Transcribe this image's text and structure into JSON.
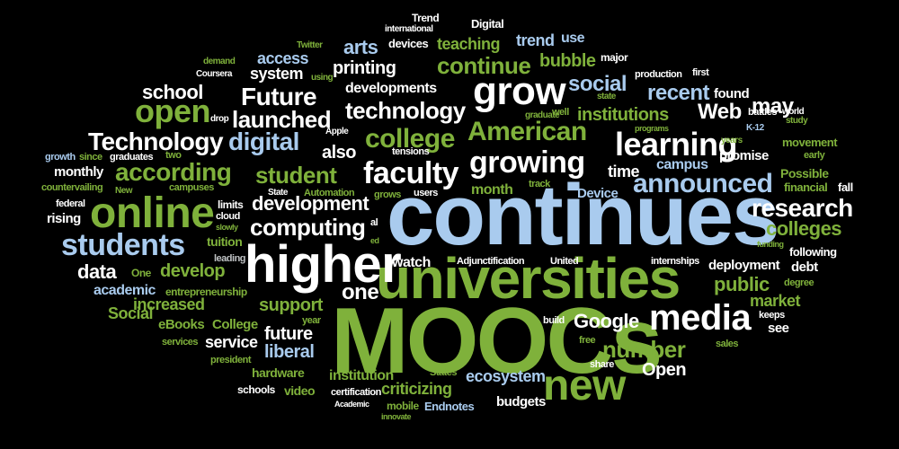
{
  "words": [
    {
      "text": "continues",
      "color": "#a9cbee"
    },
    {
      "text": "MOOCs",
      "color": "#7fb13b"
    },
    {
      "text": "universities",
      "color": "#7fb13b"
    },
    {
      "text": "higher",
      "color": "#ffffff"
    },
    {
      "text": "online",
      "color": "#7fb13b"
    },
    {
      "text": "new",
      "color": "#7fb13b"
    },
    {
      "text": "media",
      "color": "#ffffff"
    },
    {
      "text": "grow",
      "color": "#ffffff"
    },
    {
      "text": "students",
      "color": "#a9cbee"
    },
    {
      "text": "learning",
      "color": "#ffffff"
    },
    {
      "text": "growing",
      "color": "#ffffff"
    },
    {
      "text": "American",
      "color": "#7fb13b"
    },
    {
      "text": "faculty",
      "color": "#ffffff"
    },
    {
      "text": "college",
      "color": "#7fb13b"
    },
    {
      "text": "announced",
      "color": "#a9cbee"
    },
    {
      "text": "research",
      "color": "#ffffff"
    },
    {
      "text": "open",
      "color": "#7fb13b"
    },
    {
      "text": "according",
      "color": "#7fb13b"
    },
    {
      "text": "Technology",
      "color": "#ffffff"
    },
    {
      "text": "digital",
      "color": "#a9cbee"
    },
    {
      "text": "Future",
      "color": "#ffffff"
    },
    {
      "text": "launched",
      "color": "#ffffff"
    },
    {
      "text": "technology",
      "color": "#ffffff"
    },
    {
      "text": "continue",
      "color": "#7fb13b"
    },
    {
      "text": "student",
      "color": "#7fb13b"
    },
    {
      "text": "development",
      "color": "#ffffff"
    },
    {
      "text": "computing",
      "color": "#ffffff"
    },
    {
      "text": "Web",
      "color": "#ffffff"
    },
    {
      "text": "institutions",
      "color": "#7fb13b"
    },
    {
      "text": "recent",
      "color": "#a9cbee"
    },
    {
      "text": "social",
      "color": "#a9cbee"
    },
    {
      "text": "may",
      "color": "#ffffff"
    },
    {
      "text": "colleges",
      "color": "#7fb13b"
    },
    {
      "text": "arts",
      "color": "#a9cbee"
    },
    {
      "text": "teaching",
      "color": "#7fb13b"
    },
    {
      "text": "trend",
      "color": "#a9cbee"
    },
    {
      "text": "use",
      "color": "#a9cbee"
    },
    {
      "text": "bubble",
      "color": "#7fb13b"
    },
    {
      "text": "printing",
      "color": "#ffffff"
    },
    {
      "text": "developments",
      "color": "#ffffff"
    },
    {
      "text": "access",
      "color": "#a9cbee"
    },
    {
      "text": "system",
      "color": "#ffffff"
    },
    {
      "text": "school",
      "color": "#ffffff"
    },
    {
      "text": "number",
      "color": "#7fb13b"
    },
    {
      "text": "Google",
      "color": "#ffffff"
    },
    {
      "text": "public",
      "color": "#7fb13b"
    },
    {
      "text": "market",
      "color": "#7fb13b"
    },
    {
      "text": "one",
      "color": "#ffffff"
    },
    {
      "text": "data",
      "color": "#ffffff"
    },
    {
      "text": "develop",
      "color": "#7fb13b"
    },
    {
      "text": "support",
      "color": "#7fb13b"
    },
    {
      "text": "future",
      "color": "#ffffff"
    },
    {
      "text": "liberal",
      "color": "#a9cbee"
    },
    {
      "text": "increased",
      "color": "#7fb13b"
    },
    {
      "text": "Social",
      "color": "#7fb13b"
    },
    {
      "text": "service",
      "color": "#ffffff"
    },
    {
      "text": "watch",
      "color": "#ffffff"
    },
    {
      "text": "Open",
      "color": "#ffffff"
    },
    {
      "text": "criticizing",
      "color": "#7fb13b"
    },
    {
      "text": "ecosystem",
      "color": "#a9cbee"
    },
    {
      "text": "institution",
      "color": "#7fb13b"
    },
    {
      "text": "also",
      "color": "#ffffff"
    },
    {
      "text": "time",
      "color": "#ffffff"
    },
    {
      "text": "campus",
      "color": "#a9cbee"
    },
    {
      "text": "month",
      "color": "#7fb13b"
    },
    {
      "text": "Device",
      "color": "#a9cbee"
    },
    {
      "text": "deployment",
      "color": "#ffffff"
    },
    {
      "text": "debt",
      "color": "#ffffff"
    },
    {
      "text": "following",
      "color": "#ffffff"
    },
    {
      "text": "found",
      "color": "#ffffff"
    },
    {
      "text": "promise",
      "color": "#ffffff"
    },
    {
      "text": "Possible",
      "color": "#7fb13b"
    },
    {
      "text": "financial",
      "color": "#7fb13b"
    },
    {
      "text": "fall",
      "color": "#ffffff"
    },
    {
      "text": "monthly",
      "color": "#ffffff"
    },
    {
      "text": "academic",
      "color": "#a9cbee"
    },
    {
      "text": "eBooks",
      "color": "#7fb13b"
    },
    {
      "text": "College",
      "color": "#7fb13b"
    },
    {
      "text": "entrepreneurship",
      "color": "#7fb13b"
    },
    {
      "text": "tuition",
      "color": "#7fb13b"
    },
    {
      "text": "leading",
      "color": "#bfc2c4"
    },
    {
      "text": "One",
      "color": "#7fb13b"
    },
    {
      "text": "Adjunctification",
      "color": "#ffffff"
    },
    {
      "text": "United",
      "color": "#ffffff"
    },
    {
      "text": "internships",
      "color": "#ffffff"
    },
    {
      "text": "degree",
      "color": "#7fb13b"
    },
    {
      "text": "keeps",
      "color": "#ffffff"
    },
    {
      "text": "see",
      "color": "#ffffff"
    },
    {
      "text": "sales",
      "color": "#7fb13b"
    },
    {
      "text": "free",
      "color": "#7fb13b"
    },
    {
      "text": "build",
      "color": "#ffffff"
    },
    {
      "text": "share",
      "color": "#ffffff"
    },
    {
      "text": "States",
      "color": "#7fb13b"
    },
    {
      "text": "hardware",
      "color": "#7fb13b"
    },
    {
      "text": "president",
      "color": "#7fb13b"
    },
    {
      "text": "services",
      "color": "#7fb13b"
    },
    {
      "text": "schools",
      "color": "#ffffff"
    },
    {
      "text": "video",
      "color": "#7fb13b"
    },
    {
      "text": "certification",
      "color": "#ffffff"
    },
    {
      "text": "Academic",
      "color": "#ffffff"
    },
    {
      "text": "mobile",
      "color": "#7fb13b"
    },
    {
      "text": "Endnotes",
      "color": "#a9cbee"
    },
    {
      "text": "budgets",
      "color": "#ffffff"
    },
    {
      "text": "innovate",
      "color": "#7fb13b"
    },
    {
      "text": "year",
      "color": "#7fb13b"
    },
    {
      "text": "federal",
      "color": "#ffffff"
    },
    {
      "text": "rising",
      "color": "#ffffff"
    },
    {
      "text": "countervailing",
      "color": "#7fb13b"
    },
    {
      "text": "growth",
      "color": "#a9cbee"
    },
    {
      "text": "since",
      "color": "#7fb13b"
    },
    {
      "text": "graduates",
      "color": "#ffffff"
    },
    {
      "text": "two",
      "color": "#7fb13b"
    },
    {
      "text": "New",
      "color": "#7fb13b"
    },
    {
      "text": "campuses",
      "color": "#7fb13b"
    },
    {
      "text": "limits",
      "color": "#ffffff"
    },
    {
      "text": "cloud",
      "color": "#ffffff"
    },
    {
      "text": "slowly",
      "color": "#7fb13b"
    },
    {
      "text": "State",
      "color": "#ffffff"
    },
    {
      "text": "Automation",
      "color": "#7fb13b"
    },
    {
      "text": "grows",
      "color": "#7fb13b"
    },
    {
      "text": "users",
      "color": "#ffffff"
    },
    {
      "text": "tensions",
      "color": "#ffffff"
    },
    {
      "text": "track",
      "color": "#7fb13b"
    },
    {
      "text": "Apple",
      "color": "#ffffff"
    },
    {
      "text": "drop",
      "color": "#ffffff"
    },
    {
      "text": "graduate",
      "color": "#7fb13b"
    },
    {
      "text": "well",
      "color": "#7fb13b"
    },
    {
      "text": "programs",
      "color": "#7fb13b"
    },
    {
      "text": "state",
      "color": "#7fb13b"
    },
    {
      "text": "production",
      "color": "#ffffff"
    },
    {
      "text": "first",
      "color": "#ffffff"
    },
    {
      "text": "study",
      "color": "#7fb13b"
    },
    {
      "text": "battles",
      "color": "#ffffff"
    },
    {
      "text": "world",
      "color": "#ffffff"
    },
    {
      "text": "K-12",
      "color": "#a9cbee"
    },
    {
      "text": "movement",
      "color": "#7fb13b"
    },
    {
      "text": "early",
      "color": "#7fb13b"
    },
    {
      "text": "years",
      "color": "#7fb13b"
    },
    {
      "text": "funding",
      "color": "#7fb13b"
    },
    {
      "text": "major",
      "color": "#ffffff"
    },
    {
      "text": "Trend",
      "color": "#ffffff"
    },
    {
      "text": "international",
      "color": "#ffffff"
    },
    {
      "text": "Digital",
      "color": "#ffffff"
    },
    {
      "text": "devices",
      "color": "#ffffff"
    },
    {
      "text": "Twitter",
      "color": "#7fb13b"
    },
    {
      "text": "demand",
      "color": "#7fb13b"
    },
    {
      "text": "Coursera",
      "color": "#ffffff"
    },
    {
      "text": "using",
      "color": "#7fb13b"
    },
    {
      "text": "al",
      "color": "#ffffff"
    },
    {
      "text": "ed",
      "color": "#7fb13b"
    }
  ]
}
